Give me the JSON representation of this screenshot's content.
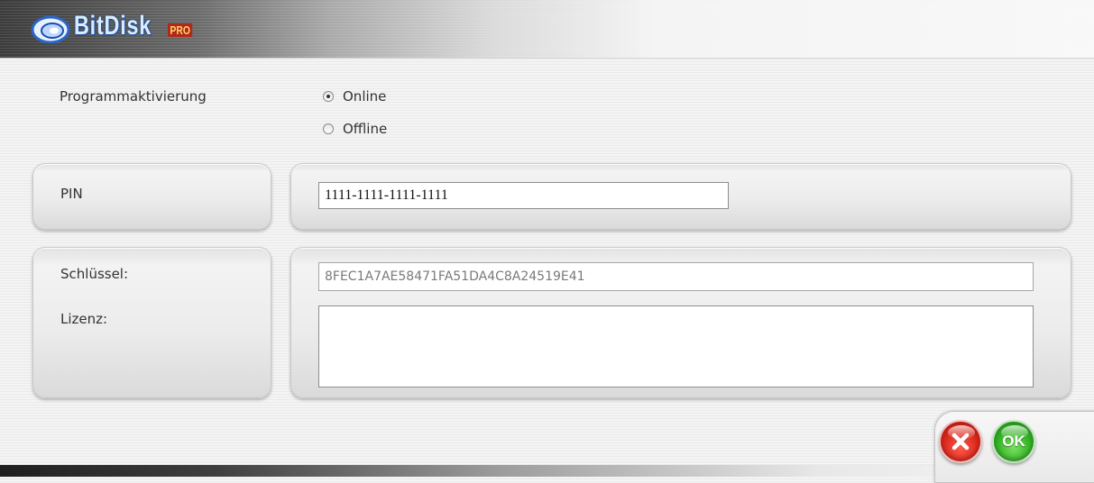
{
  "window": {
    "logo_text": "BitDisk",
    "logo_badge": "PRO"
  },
  "activation": {
    "label": "Programmaktivierung",
    "options": [
      {
        "label": "Online",
        "checked": true
      },
      {
        "label": "Offline",
        "checked": false
      }
    ]
  },
  "pin": {
    "label": "PIN",
    "value": "1111-1111-1111-1111"
  },
  "key": {
    "label": "Schlüssel:",
    "value": "8FEC1A7AE58471FA51DA4C8A24519E41"
  },
  "license": {
    "label": "Lizenz:",
    "value": ""
  },
  "buttons": {
    "cancel_icon": "close-icon",
    "ok_label": "OK"
  }
}
